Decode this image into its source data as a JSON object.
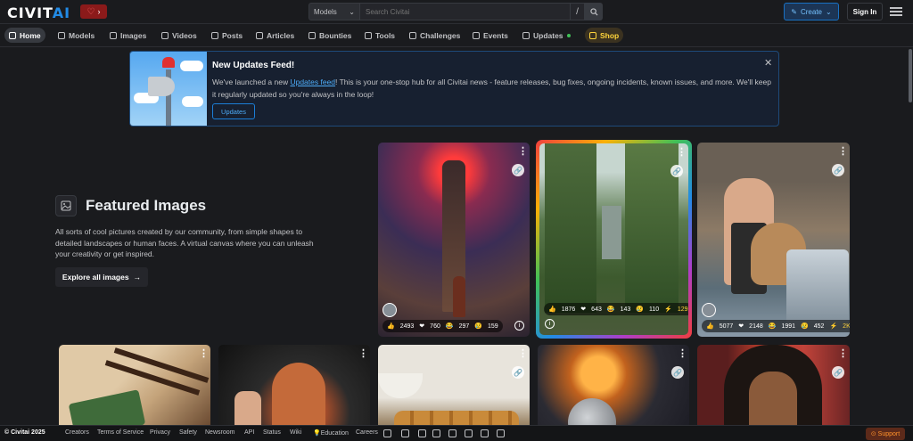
{
  "header": {
    "logo_main": "CIVIT",
    "logo_ai": "AI",
    "search_category": "Models",
    "search_placeholder": "Search Civitai",
    "search_shortcut": "/",
    "create_label": "Create",
    "signin_label": "Sign In"
  },
  "nav": {
    "items": [
      {
        "label": "Home",
        "icon": "home-icon"
      },
      {
        "label": "Models",
        "icon": "grid-icon"
      },
      {
        "label": "Images",
        "icon": "photo-icon"
      },
      {
        "label": "Videos",
        "icon": "video-icon"
      },
      {
        "label": "Posts",
        "icon": "posts-icon"
      },
      {
        "label": "Articles",
        "icon": "article-icon"
      },
      {
        "label": "Bounties",
        "icon": "moneybag-icon"
      },
      {
        "label": "Tools",
        "icon": "tools-icon"
      },
      {
        "label": "Challenges",
        "icon": "trophy-icon"
      },
      {
        "label": "Events",
        "icon": "calendar-icon"
      },
      {
        "label": "Updates",
        "icon": "news-icon"
      },
      {
        "label": "Shop",
        "icon": "shop-icon"
      }
    ]
  },
  "banner": {
    "title": "New Updates Feed!",
    "text_before": "We've launched a new ",
    "link": "Updates feed",
    "text_after": "! This is your one-stop hub for all Civitai news - feature releases, bug fixes, ongoing incidents, known issues, and more. We'll keep it regularly updated so you're always in the loop!",
    "button": "Updates"
  },
  "featured": {
    "title": "Featured Images",
    "description": "All sorts of cool pictures created by our community, from simple shapes to detailed landscapes or human faces. A virtual canvas where you can unleash your creativity or get inspired.",
    "explore_label": "Explore all images",
    "explore_arrow": "→"
  },
  "cards": [
    {
      "likes": "2493",
      "hearts": "760",
      "laughs": "297",
      "cries": "159",
      "extra": ""
    },
    {
      "likes": "1876",
      "hearts": "643",
      "laughs": "143",
      "cries": "110",
      "extra": "129"
    },
    {
      "likes": "5077",
      "hearts": "2148",
      "laughs": "1991",
      "cries": "452",
      "extra": "2K"
    }
  ],
  "footer": {
    "copyright": "© Civitai 2025",
    "links": [
      "Creators",
      "Terms of Service",
      "Privacy",
      "Safety",
      "Newsroom",
      "API",
      "Status",
      "Wiki",
      "Education",
      "Careers"
    ],
    "support": "Support"
  },
  "colors": {
    "accent": "#228be6",
    "background": "#1a1b1e",
    "shop": "#ffd43b"
  }
}
